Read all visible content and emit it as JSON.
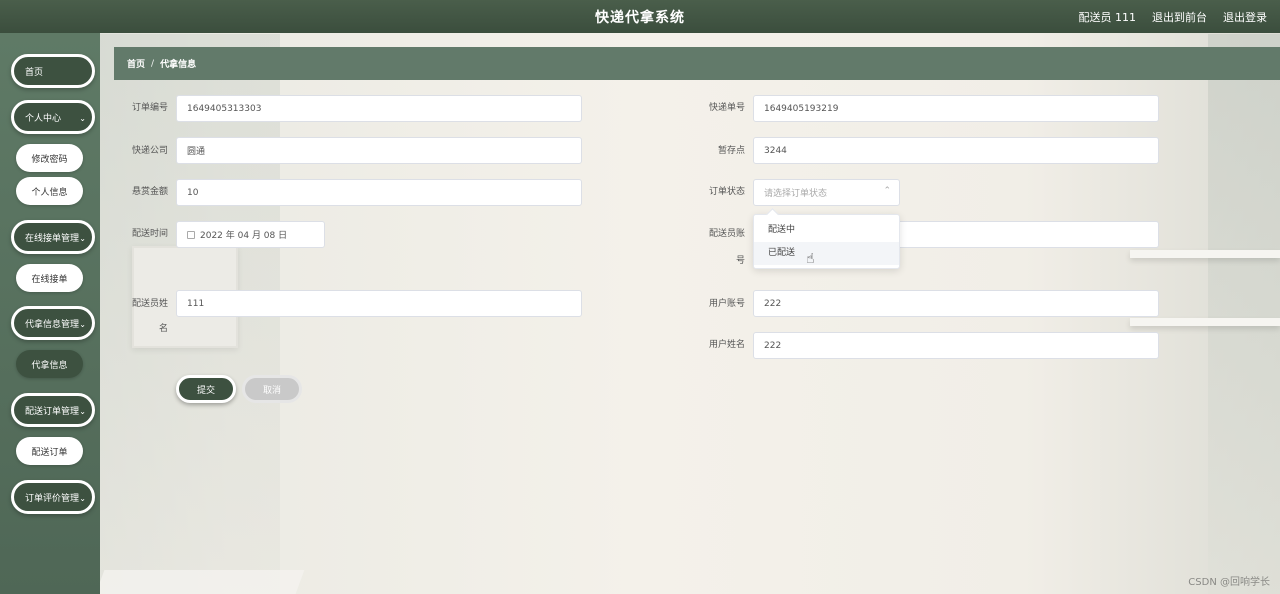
{
  "header": {
    "title": "快递代拿系统",
    "user": "配送员 111",
    "exit_front": "退出到前台",
    "logout": "退出登录"
  },
  "sidebar": {
    "home": "首页",
    "personal_center": "个人中心",
    "change_password": "修改密码",
    "personal_info": "个人信息",
    "online_orders_mgmt": "在线接单管理",
    "online_orders": "在线接单",
    "pickup_info_mgmt": "代拿信息管理",
    "pickup_info": "代拿信息",
    "delivery_orders_mgmt": "配送订单管理",
    "delivery_orders": "配送订单",
    "order_review_mgmt": "订单评价管理"
  },
  "breadcrumb": {
    "home": "首页",
    "separator": "/",
    "current": "代拿信息"
  },
  "form": {
    "order_no": {
      "label": "订单编号",
      "value": "1649405313303"
    },
    "tracking_no": {
      "label": "快递单号",
      "value": "1649405193219"
    },
    "courier": {
      "label": "快递公司",
      "value": "圆通"
    },
    "storage": {
      "label": "暂存点",
      "value": "3244"
    },
    "reward": {
      "label": "悬赏金额",
      "value": "10"
    },
    "status": {
      "label": "订单状态",
      "placeholder": "请选择订单状态"
    },
    "delivery_time": {
      "label": "配送时间",
      "value": "2022 年 04 月 08 日"
    },
    "courier_account": {
      "label_line1": "配送员账",
      "label_line2": "号"
    },
    "courier_name": {
      "label_line1": "配送员姓",
      "label_line2": "名",
      "value": "111"
    },
    "user_account": {
      "label": "用户账号",
      "value": "222"
    },
    "user_name": {
      "label": "用户姓名",
      "value": "222"
    },
    "submit": "提交",
    "cancel": "取消"
  },
  "status_options": [
    "配送中",
    "已配送"
  ],
  "watermark": "CSDN @回响学长"
}
